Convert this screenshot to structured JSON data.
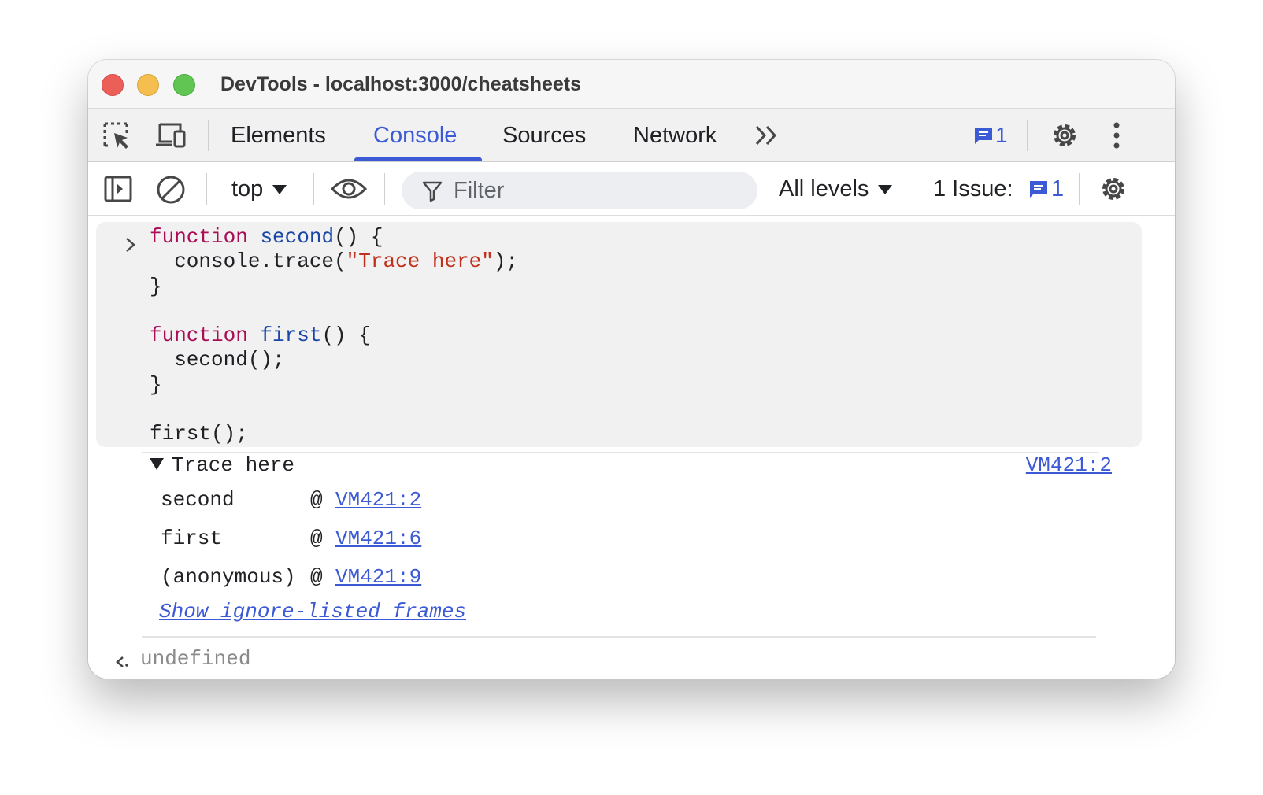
{
  "window": {
    "title": "DevTools - localhost:3000/cheatsheets"
  },
  "tabs": [
    {
      "label": "Elements",
      "active": false
    },
    {
      "label": "Console",
      "active": true
    },
    {
      "label": "Sources",
      "active": false
    },
    {
      "label": "Network",
      "active": false
    }
  ],
  "tabbar": {
    "messages_count": "1"
  },
  "console_toolbar": {
    "context": "top",
    "filter_placeholder": "Filter",
    "levels": "All levels",
    "issues_label": "1 Issue:",
    "issues_count": "1"
  },
  "code": {
    "lines": [
      [
        {
          "t": "function",
          "c": "kw"
        },
        {
          "t": " ",
          "c": ""
        },
        {
          "t": "second",
          "c": "fn"
        },
        {
          "t": "() {",
          "c": ""
        }
      ],
      [
        {
          "t": "  console.trace(",
          "c": ""
        },
        {
          "t": "\"Trace here\"",
          "c": "str"
        },
        {
          "t": ");",
          "c": ""
        }
      ],
      [
        {
          "t": "}",
          "c": ""
        }
      ],
      [
        {
          "t": "",
          "c": ""
        }
      ],
      [
        {
          "t": "function",
          "c": "kw"
        },
        {
          "t": " ",
          "c": ""
        },
        {
          "t": "first",
          "c": "fn"
        },
        {
          "t": "() {",
          "c": ""
        }
      ],
      [
        {
          "t": "  second();",
          "c": ""
        }
      ],
      [
        {
          "t": "}",
          "c": ""
        }
      ],
      [
        {
          "t": "",
          "c": ""
        }
      ],
      [
        {
          "t": "first();",
          "c": ""
        }
      ]
    ]
  },
  "trace": {
    "message": "Trace here",
    "source": "VM421:2",
    "frames": [
      {
        "fn": "second",
        "at": "@",
        "loc": "VM421:2"
      },
      {
        "fn": "first",
        "at": "@",
        "loc": "VM421:6"
      },
      {
        "fn": "(anonymous)",
        "at": "@",
        "loc": "VM421:9"
      }
    ],
    "ignore_listed": "Show ignore-listed frames"
  },
  "result": {
    "value": "undefined"
  },
  "colors": {
    "accent": "#3d5ad6",
    "keyword": "#aa0d56",
    "function": "#1a46a6",
    "string": "#c0301d"
  }
}
